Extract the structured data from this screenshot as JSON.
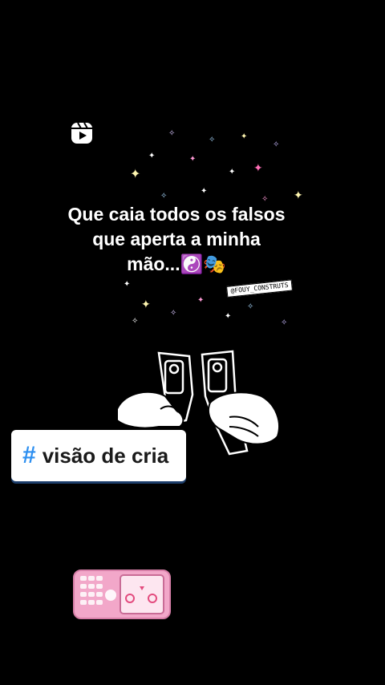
{
  "post": {
    "reels_icon": "reels-icon",
    "caption_lines": [
      "Que caia todos os falsos",
      "que aperta a minha",
      "mão...☯️🎭"
    ],
    "watermark": "@FOUY_CONSTRUTS",
    "hashtag": {
      "symbol": "#",
      "text": "visão de cria"
    },
    "colors": {
      "background": "#000000",
      "hashtag_symbol": "#2d8ff0",
      "sticker_shadow": "#1c3d6a",
      "phone_pink": "#f2a7c9"
    }
  }
}
